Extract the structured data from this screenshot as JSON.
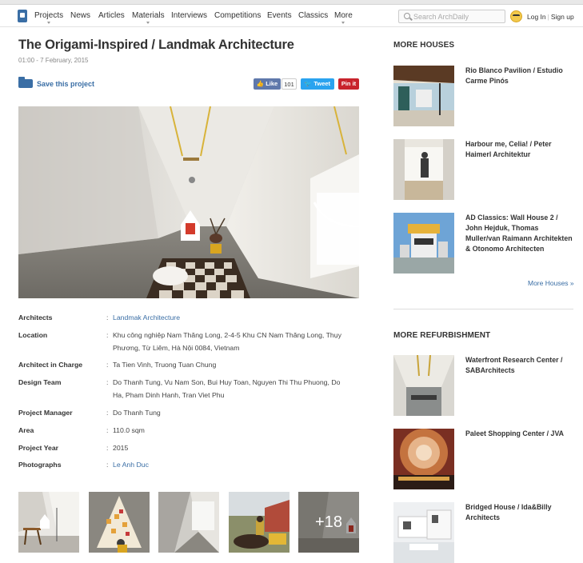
{
  "nav": {
    "items": [
      "Projects",
      "News",
      "Articles",
      "Materials",
      "Interviews",
      "Competitions",
      "Events",
      "Classics",
      "More"
    ],
    "search_placeholder": "Search ArchDaily",
    "login": "Log In",
    "signup": "Sign up"
  },
  "article": {
    "title": "The Origami-Inspired / Landmak Architecture",
    "date": "01:00 - 7 February, 2015",
    "save_label": "Save this project",
    "like_label": "Like",
    "like_count": "101",
    "tweet_label": "Tweet",
    "pin_label": "Pin it"
  },
  "specs": [
    {
      "key": "Architects",
      "value": "Landmak Architecture",
      "link": true
    },
    {
      "key": "Location",
      "value": "Khu công nghiệp Nam Thăng Long, 2-4-5 Khu CN Nam Thăng Long, Thụy Phương, Từ Liêm, Hà Nội 0084, Vietnam",
      "link": false
    },
    {
      "key": "Architect in Charge",
      "value": "Ta Tien Vinh, Truong Tuan Chung",
      "link": false
    },
    {
      "key": "Design Team",
      "value": "Do Thanh Tung, Vu Nam Son, Bui Huy Toan, Nguyen Thi Thu Phuong, Do Ha, Pham Dinh Hanh, Tran Viet Phu",
      "link": false
    },
    {
      "key": "Project Manager",
      "value": "Do Thanh Tung",
      "link": false
    },
    {
      "key": "Area",
      "value": "110.0 sqm",
      "link": false
    },
    {
      "key": "Project Year",
      "value": "2015",
      "link": false
    },
    {
      "key": "Photographs",
      "value": "Le Anh Duc",
      "link": true
    }
  ],
  "gallery": {
    "more_label": "+18"
  },
  "sidebar": {
    "houses_title": "MORE HOUSES",
    "houses": [
      {
        "title": "Rio Blanco Pavilion / Estudio Carme Pinós"
      },
      {
        "title": "Harbour me, Celia! / Peter Haimerl Architektur"
      },
      {
        "title": "AD Classics: Wall House 2 / John Hejduk, Thomas Muller/van Raimann Architekten & Otonomo Architecten"
      }
    ],
    "houses_more": "More Houses »",
    "refurb_title": "MORE REFURBISHMENT",
    "refurb": [
      {
        "title": "Waterfront Research Center / SABArchitects"
      },
      {
        "title": "Paleet Shopping Center / JVA"
      },
      {
        "title": "Bridged House / Ida&Billy Architects"
      }
    ]
  }
}
